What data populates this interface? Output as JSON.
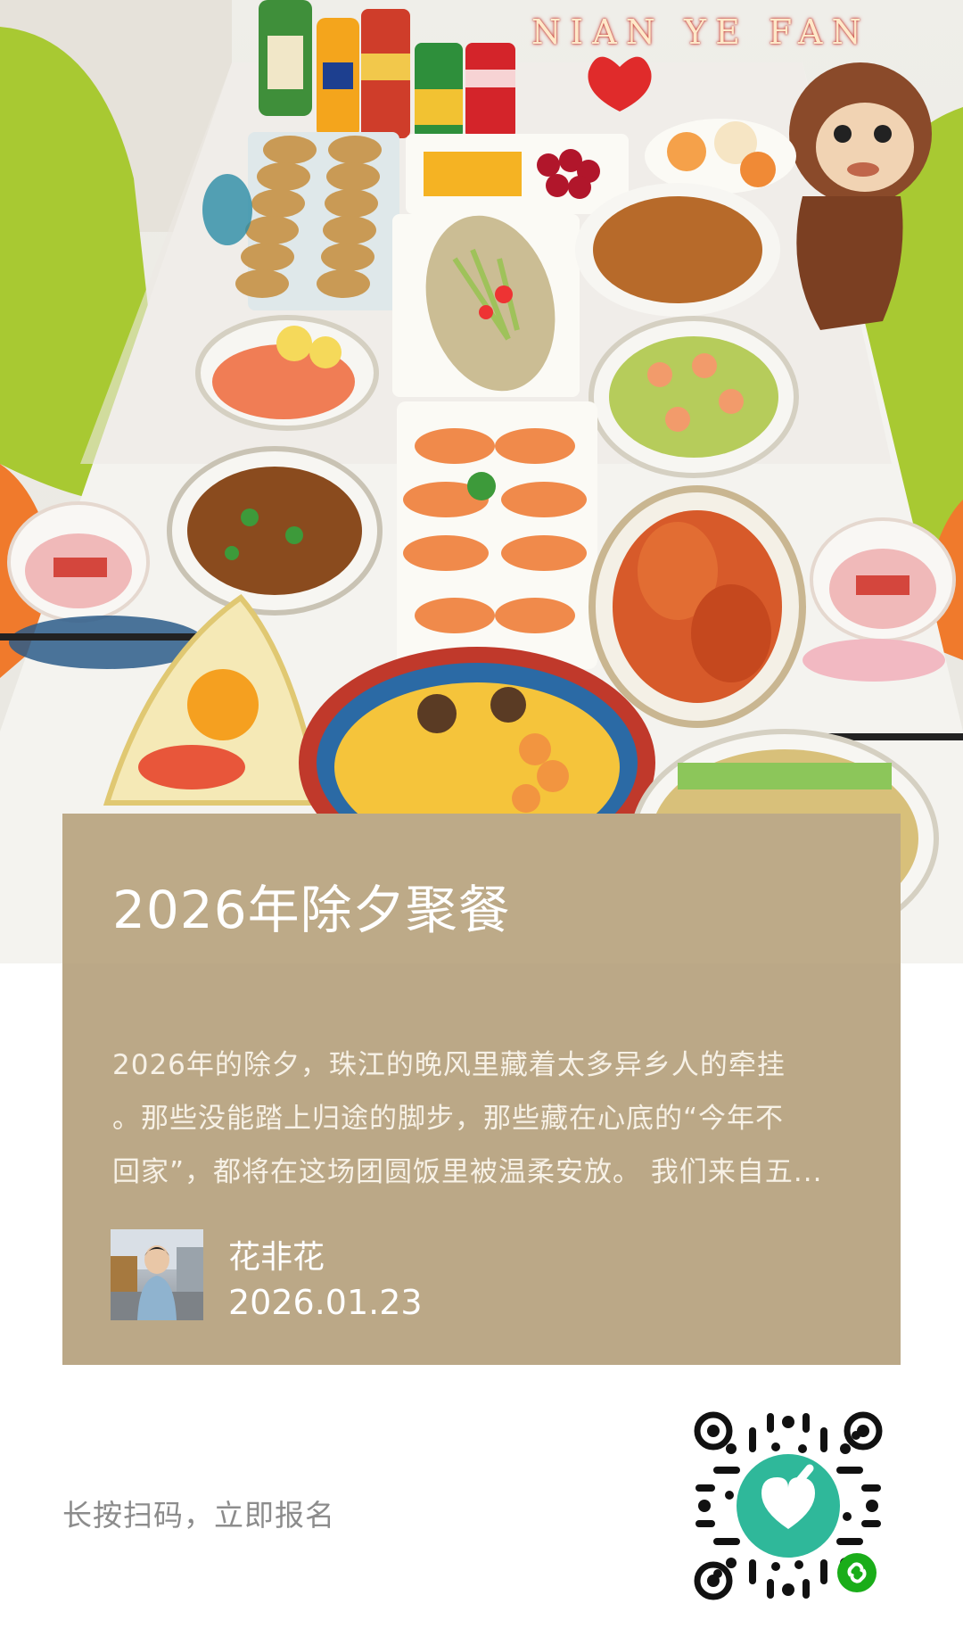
{
  "hero": {
    "banner_text": "NIAN YE FAN"
  },
  "card": {
    "title": "2026年除夕聚餐",
    "description_lines": [
      "2026年的除夕，珠江的晚风里藏着太多异乡人的牵挂",
      "。那些没能踏上归途的脚步，那些藏在心底的“今年不",
      "回家”，都将在这场团圆饭里被温柔安放。 我们来自五..."
    ],
    "author": "花非花",
    "date": "2026.01.23"
  },
  "footer": {
    "scan_tip": "长按扫码，立即报名"
  },
  "icons": {
    "avatar": "user-avatar-photo",
    "qr": "mini-program-qr-code-icon",
    "badge": "mini-program-link-icon"
  },
  "colors": {
    "card": "#bba887",
    "qr_center": "#2fb89a",
    "badge": "#1aad19"
  }
}
